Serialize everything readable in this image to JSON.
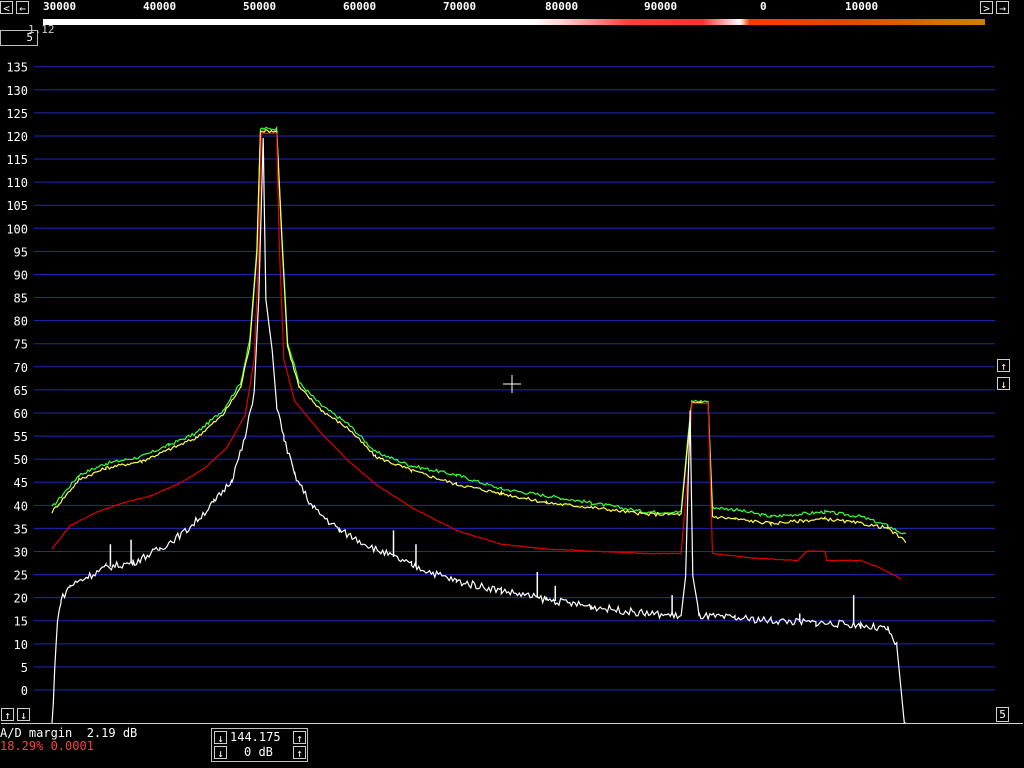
{
  "header": {
    "freq_ticks": [
      "30000",
      "40000",
      "50000",
      "60000",
      "70000",
      "80000",
      "90000",
      "0",
      "10000"
    ],
    "version_label": "1.12",
    "corner_box_label": "5",
    "right_box_label": "5"
  },
  "status": {
    "ad_margin": "A/D margin  2.19 dB",
    "stats": "18.29% 0.0001",
    "freq_value": "144.175",
    "gain_value": "0 dB"
  },
  "colors": {
    "background": "#000000",
    "grid": "#1e28b8",
    "white_trace": "#ffffff",
    "green_trace": "#3cff3c",
    "yellow_trace": "#ffff50",
    "red_trace": "#e00000",
    "stats_text": "#ff4040"
  },
  "chart_data": {
    "type": "line",
    "ylim": [
      -5,
      137
    ],
    "y_ticks": [
      "135",
      "130",
      "125",
      "120",
      "115",
      "110",
      "105",
      "100",
      "95",
      "90",
      "85",
      "80",
      "75",
      "70",
      "65",
      "60",
      "55",
      "50",
      "45",
      "40",
      "35",
      "30",
      "25",
      "20",
      "15",
      "10",
      "5",
      "0"
    ],
    "x_range_bins": [
      0,
      1000
    ],
    "series": [
      {
        "color": "green_trace",
        "points": [
          [
            0,
            40
          ],
          [
            30,
            47
          ],
          [
            60,
            49.5
          ],
          [
            100,
            51
          ],
          [
            130,
            53.5
          ],
          [
            160,
            56
          ],
          [
            190,
            61
          ],
          [
            210,
            67
          ],
          [
            220,
            76
          ],
          [
            228,
            96
          ],
          [
            232,
            122
          ],
          [
            250,
            122
          ],
          [
            256,
            98
          ],
          [
            262,
            76
          ],
          [
            275,
            67
          ],
          [
            300,
            62
          ],
          [
            330,
            58
          ],
          [
            360,
            52
          ],
          [
            400,
            49
          ],
          [
            450,
            47
          ],
          [
            500,
            44
          ],
          [
            550,
            42.5
          ],
          [
            600,
            41
          ],
          [
            660,
            39
          ],
          [
            700,
            39
          ],
          [
            708,
            56
          ],
          [
            712,
            63
          ],
          [
            730,
            63
          ],
          [
            735,
            40
          ],
          [
            760,
            39.5
          ],
          [
            800,
            38
          ],
          [
            860,
            39
          ],
          [
            900,
            38
          ],
          [
            930,
            36
          ],
          [
            950,
            34
          ]
        ]
      },
      {
        "color": "yellow_trace",
        "points": [
          [
            0,
            39
          ],
          [
            30,
            46
          ],
          [
            60,
            48.5
          ],
          [
            100,
            50
          ],
          [
            130,
            52.5
          ],
          [
            160,
            55
          ],
          [
            190,
            60
          ],
          [
            210,
            66
          ],
          [
            220,
            75
          ],
          [
            228,
            95
          ],
          [
            232,
            121.5
          ],
          [
            250,
            121.5
          ],
          [
            256,
            97
          ],
          [
            262,
            75
          ],
          [
            275,
            66
          ],
          [
            300,
            61
          ],
          [
            330,
            57
          ],
          [
            360,
            51
          ],
          [
            400,
            48
          ],
          [
            450,
            45
          ],
          [
            500,
            43
          ],
          [
            550,
            41
          ],
          [
            600,
            40
          ],
          [
            660,
            38.5
          ],
          [
            700,
            38.5
          ],
          [
            708,
            55
          ],
          [
            712,
            62.5
          ],
          [
            730,
            62.5
          ],
          [
            735,
            38
          ],
          [
            760,
            37.5
          ],
          [
            800,
            36.5
          ],
          [
            860,
            37.5
          ],
          [
            900,
            36.5
          ],
          [
            930,
            35.5
          ],
          [
            950,
            32.5
          ]
        ]
      },
      {
        "color": "red_trace",
        "points": [
          [
            0,
            31
          ],
          [
            20,
            36
          ],
          [
            50,
            39
          ],
          [
            80,
            41
          ],
          [
            110,
            42.5
          ],
          [
            140,
            45
          ],
          [
            170,
            48.5
          ],
          [
            195,
            53
          ],
          [
            215,
            60
          ],
          [
            225,
            72
          ],
          [
            230,
            95
          ],
          [
            233,
            121
          ],
          [
            250,
            121
          ],
          [
            253,
            96
          ],
          [
            258,
            72
          ],
          [
            270,
            63
          ],
          [
            300,
            56
          ],
          [
            330,
            50
          ],
          [
            360,
            45
          ],
          [
            400,
            40
          ],
          [
            450,
            35
          ],
          [
            500,
            32
          ],
          [
            550,
            31
          ],
          [
            600,
            30.5
          ],
          [
            660,
            30
          ],
          [
            700,
            30
          ],
          [
            708,
            48
          ],
          [
            712,
            62.5
          ],
          [
            730,
            62.5
          ],
          [
            735,
            30
          ],
          [
            780,
            29
          ],
          [
            830,
            28.5
          ],
          [
            840,
            30.5
          ],
          [
            860,
            30.5
          ],
          [
            862,
            28.5
          ],
          [
            900,
            28.5
          ],
          [
            920,
            27
          ],
          [
            945,
            24.5
          ]
        ]
      },
      {
        "color": "white_trace",
        "points": [
          [
            0,
            -10
          ],
          [
            3,
            5
          ],
          [
            6,
            15
          ],
          [
            10,
            20
          ],
          [
            20,
            23
          ],
          [
            40,
            25
          ],
          [
            60,
            27
          ],
          [
            90,
            28
          ],
          [
            120,
            31
          ],
          [
            150,
            35
          ],
          [
            180,
            41
          ],
          [
            200,
            46
          ],
          [
            215,
            55
          ],
          [
            225,
            65
          ],
          [
            230,
            85
          ],
          [
            235,
            120
          ],
          [
            238,
            85
          ],
          [
            245,
            74
          ],
          [
            250,
            62
          ],
          [
            258,
            55
          ],
          [
            270,
            47
          ],
          [
            290,
            40
          ],
          [
            320,
            35
          ],
          [
            360,
            31
          ],
          [
            400,
            27.5
          ],
          [
            450,
            24
          ],
          [
            500,
            22
          ],
          [
            550,
            20
          ],
          [
            600,
            18.5
          ],
          [
            660,
            17
          ],
          [
            700,
            16.5
          ],
          [
            705,
            25
          ],
          [
            710,
            61
          ],
          [
            713,
            25
          ],
          [
            720,
            16.5
          ],
          [
            760,
            16
          ],
          [
            800,
            15.5
          ],
          [
            850,
            15
          ],
          [
            900,
            14.5
          ],
          [
            930,
            13.5
          ],
          [
            940,
            10
          ],
          [
            945,
            0
          ],
          [
            950,
            -10
          ]
        ]
      }
    ],
    "spikes": [
      [
        65,
        32
      ],
      [
        88,
        33
      ],
      [
        380,
        35
      ],
      [
        405,
        32
      ],
      [
        540,
        26
      ],
      [
        560,
        23
      ],
      [
        690,
        21
      ],
      [
        832,
        17
      ],
      [
        892,
        21
      ]
    ],
    "cursor": "crosshair"
  }
}
